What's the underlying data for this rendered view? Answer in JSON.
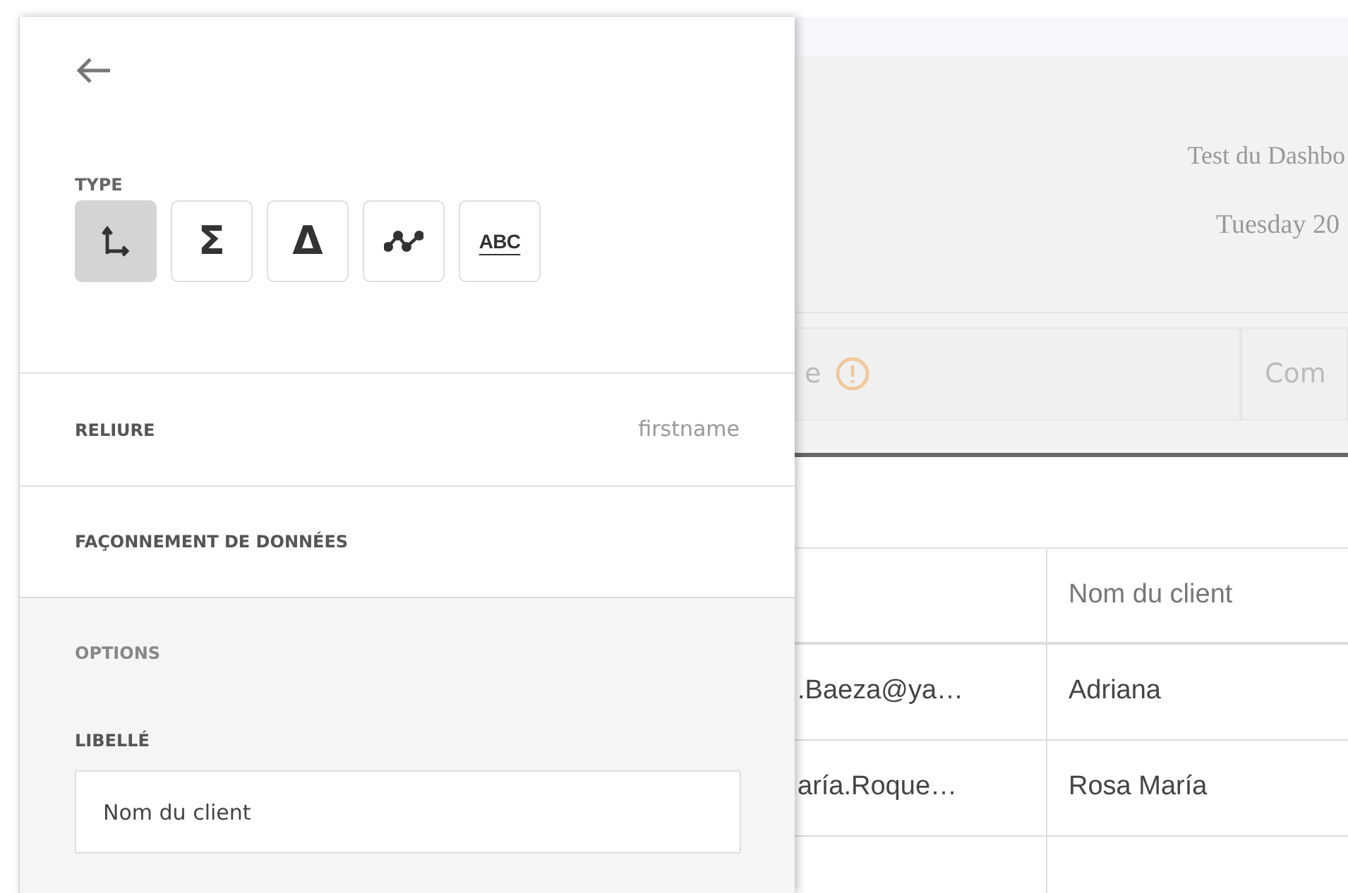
{
  "panel": {
    "type_label": "TYPE",
    "type_buttons": [
      {
        "kind": "axes",
        "selected": true
      },
      {
        "kind": "glyph",
        "label": "Σ",
        "selected": false
      },
      {
        "kind": "glyph",
        "label": "Δ",
        "selected": false
      },
      {
        "kind": "line",
        "selected": false
      },
      {
        "kind": "text",
        "label": "ABC",
        "selected": false
      }
    ],
    "binding": {
      "label": "RELIURE",
      "value": "firstname"
    },
    "shaping": {
      "label": "FAÇONNEMENT DE DONNÉES"
    },
    "options": {
      "title": "OPTIONS",
      "field_label": "LIBELLÉ",
      "field_value": "Nom du client"
    }
  },
  "dashboard": {
    "title": "Test du Dashbo",
    "date": "Tuesday 20",
    "filters": [
      {
        "label": "e",
        "warning": true
      },
      {
        "label": "Com",
        "warning": false
      }
    ],
    "table": {
      "columns": [
        "",
        "Nom du client"
      ],
      "rows": [
        [
          ".Baeza@ya…",
          "Adriana"
        ],
        [
          "aría.Roque…",
          "Rosa María"
        ]
      ]
    }
  }
}
